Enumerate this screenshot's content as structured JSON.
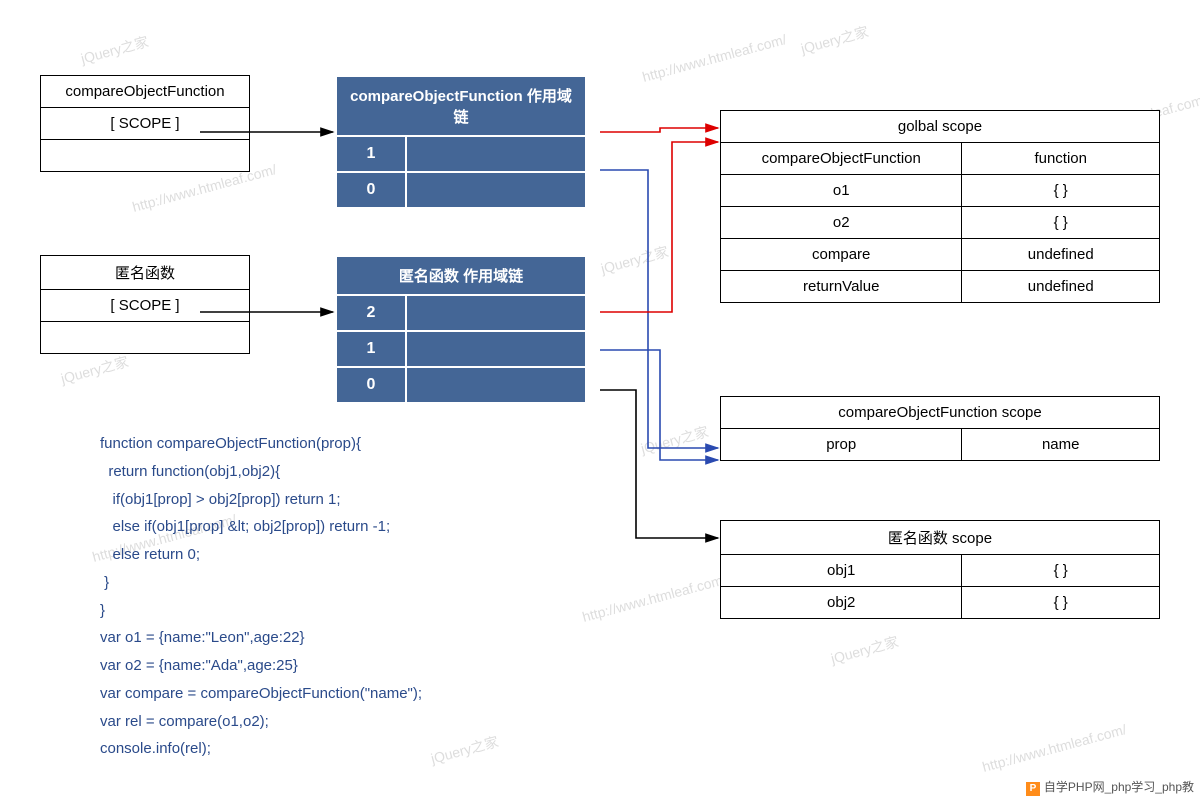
{
  "boxes": {
    "compareFn": {
      "title": "compareObjectFunction",
      "scope": "[ SCOPE ]"
    },
    "anonFn": {
      "title": "匿名函数",
      "scope": "[ SCOPE ]"
    },
    "chain1": {
      "title": "compareObjectFunction 作用域链",
      "rows": [
        "1",
        "0"
      ]
    },
    "chain2": {
      "title": "匿名函数 作用域链",
      "rows": [
        "2",
        "1",
        "0"
      ]
    }
  },
  "globalScope": {
    "title": "golbal scope",
    "rows": [
      [
        "compareObjectFunction",
        "function"
      ],
      [
        "o1",
        "{ }"
      ],
      [
        "o2",
        "{ }"
      ],
      [
        "compare",
        "undefined"
      ],
      [
        "returnValue",
        "undefined"
      ]
    ]
  },
  "cofScope": {
    "title": "compareObjectFunction scope",
    "rows": [
      [
        "prop",
        "name"
      ]
    ]
  },
  "anonScope": {
    "title": "匿名函数 scope",
    "rows": [
      [
        "obj1",
        "{ }"
      ],
      [
        "obj2",
        "{ }"
      ]
    ]
  },
  "code": "function compareObjectFunction(prop){\n  return function(obj1,obj2){\n   if(obj1[prop] > obj2[prop]) return 1;\n   else if(obj1[prop] &lt; obj2[prop]) return -1;\n   else return 0;\n }\n}\nvar o1 = {name:\"Leon\",age:22}\nvar o2 = {name:\"Ada\",age:25}\nvar compare = compareObjectFunction(\"name\");\nvar rel = compare(o1,o2);\nconsole.info(rel);",
  "watermarks": {
    "a": "jQuery之家",
    "b": "http://www.htmleaf.com/"
  },
  "footer": {
    "badge": "P",
    "text": "自学PHP网_php学习_php教"
  }
}
